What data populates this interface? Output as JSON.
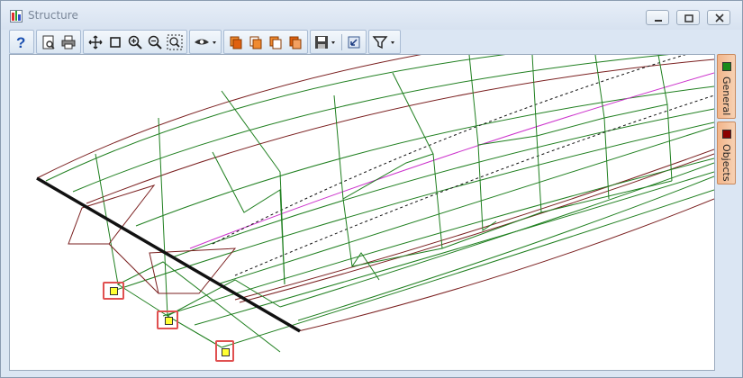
{
  "window": {
    "title": "Structure",
    "controls": [
      "minimize",
      "restore",
      "close"
    ]
  },
  "toolbar": {
    "groups": [
      [
        "help-icon"
      ],
      [
        "print-preview-icon",
        "print-icon"
      ],
      [
        "pan-icon",
        "select-rectangle-icon",
        "zoom-in-icon",
        "zoom-out-icon",
        "zoom-extents-icon"
      ],
      [
        "view-eye-dropdown"
      ],
      [
        "copy-orange-icon",
        "copy-orange-2-icon",
        "copy-orange-3-icon",
        "copy-orange-4-icon"
      ],
      [
        "save-dropdown",
        "reset-view-icon"
      ],
      [
        "filter-dropdown"
      ]
    ]
  },
  "side_tabs": [
    {
      "label": "General",
      "color": "#1a8a1a"
    },
    {
      "label": "Objects",
      "color": "#8b0000"
    }
  ],
  "viewport": {
    "content": "3D wireframe bridge structure",
    "highlighted_nodes": 3
  },
  "colors": {
    "wire_green": "#1f7f1f",
    "wire_dark_red": "#7a1f1f",
    "wire_magenta": "#cc33cc",
    "highlight_box": "#e05050",
    "node_yellow": "#ffff33"
  }
}
